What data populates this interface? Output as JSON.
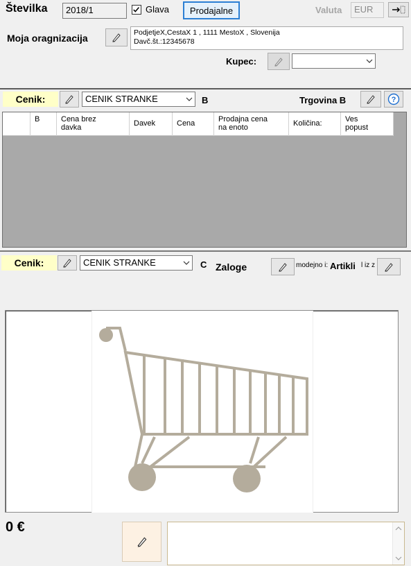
{
  "header": {
    "stevilka_label": "Številka",
    "stevilka_value": "2018/1",
    "glava_label": "Glava",
    "glava_checked": true,
    "prodajalne_label": "Prodajalne",
    "valuta_label": "Valuta",
    "valuta_value": "EUR"
  },
  "org": {
    "label": "Moja oragnizacija",
    "line1": "PodjetjeX,CestaX 1 , 1111 MestoX , Slovenija",
    "line2": "Davč.št.:12345678",
    "kupec_label": "Kupec:",
    "kupec_value": ""
  },
  "section_b": {
    "cenik_label": "Cenik:",
    "cenik_value": "CENIK STRANKE",
    "marker": "B",
    "trgovina_label": "Trgovina B",
    "help_icon": "question-circle-icon",
    "columns": [
      "",
      "B",
      "Cena brez\ndavka",
      "Davek",
      "Cena",
      "Prodajna cena\nna enoto",
      "Količina:",
      "Ves\npopust"
    ]
  },
  "section_c": {
    "cenik_label": "Cenik:",
    "cenik_value": "CENIK STRANKE",
    "marker": "C",
    "zaloge_label": "Zaloge",
    "modejno_label": "modejno i:",
    "artikli_label": "Artikli",
    "iz_label": "l iz z",
    "image_icon": "shopping-cart-icon"
  },
  "footer": {
    "total": "0 €",
    "note_value": ""
  },
  "colors": {
    "cenik_bg": "#ffffc8",
    "grid_bg": "#a9a9a9",
    "cart": "#b4ac9c",
    "accent_border": "#2b7fd4"
  }
}
